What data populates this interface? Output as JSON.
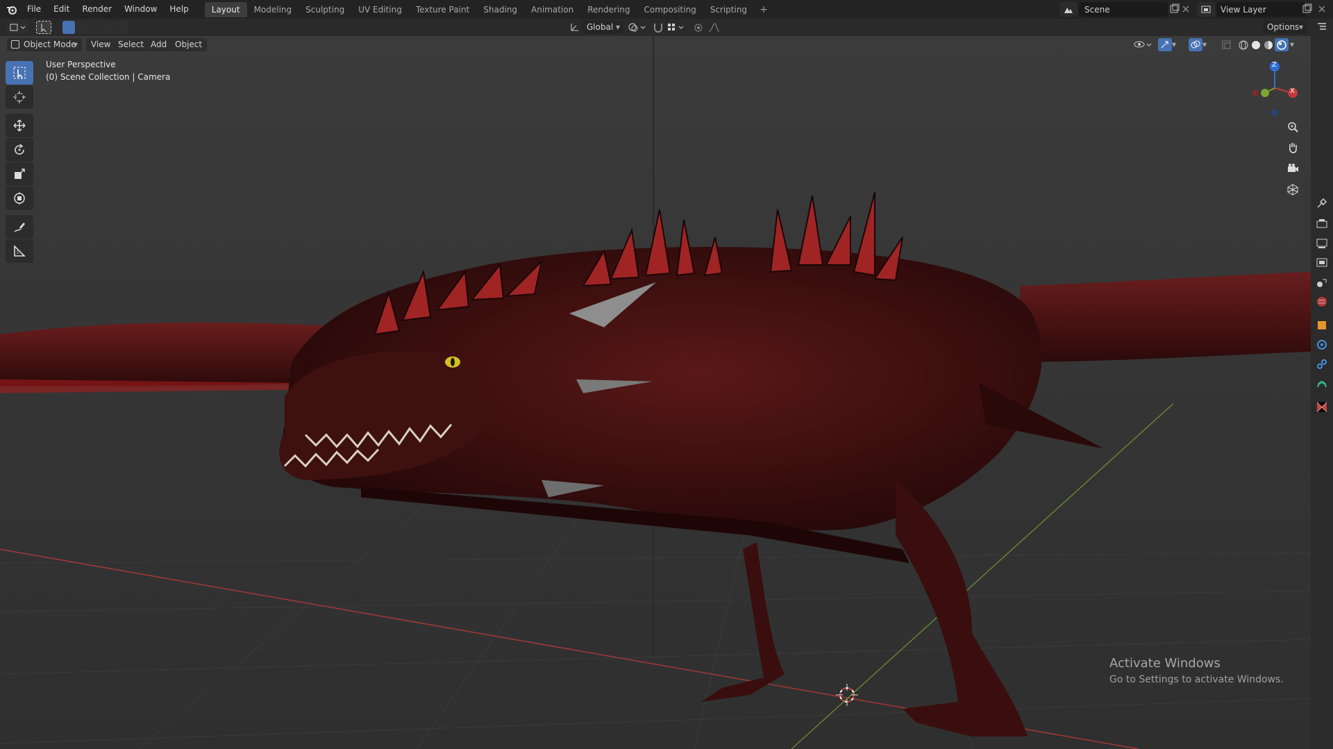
{
  "menu": {
    "items": [
      "File",
      "Edit",
      "Render",
      "Window",
      "Help"
    ]
  },
  "workspaces": {
    "tabs": [
      "Layout",
      "Modeling",
      "Sculpting",
      "UV Editing",
      "Texture Paint",
      "Shading",
      "Animation",
      "Rendering",
      "Compositing",
      "Scripting"
    ],
    "active": "Layout",
    "add": "+"
  },
  "scene": {
    "label": "Scene"
  },
  "view_layer": {
    "label": "View Layer"
  },
  "toolrow": {
    "orientation": "Global",
    "options": "Options"
  },
  "header": {
    "mode": "Object Mode",
    "menus": [
      "View",
      "Select",
      "Add",
      "Object"
    ]
  },
  "viewport": {
    "perspective": "User Perspective",
    "collection": "(0) Scene Collection | Camera"
  },
  "gizmo": {
    "z": "Z",
    "x": "X"
  },
  "watermark": {
    "title": "Activate Windows",
    "subtitle": "Go to Settings to activate Windows."
  },
  "colors": {
    "accent": "#4772b3",
    "x_axis": "#c23b3b",
    "y_axis": "#7aa631",
    "z_axis": "#2f6fd8"
  },
  "icons": {
    "left_tools": [
      "select-box-icon",
      "cursor-icon",
      "move-icon",
      "rotate-icon",
      "scale-icon",
      "transform-icon",
      "annotate-icon",
      "measure-icon"
    ],
    "right_nav": [
      "zoom-icon",
      "pan-hand-icon",
      "camera-view-icon",
      "ortho-grid-icon"
    ]
  }
}
